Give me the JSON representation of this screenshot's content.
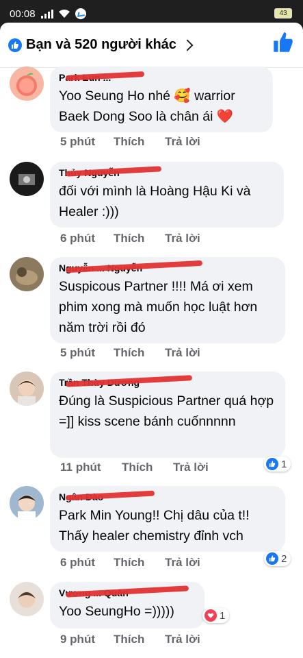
{
  "status_bar": {
    "time": "00:08",
    "battery": "43"
  },
  "header": {
    "title": "Bạn và 520 người khác"
  },
  "comments": [
    {
      "author": "Park Eun ...",
      "text": "Yoo Seung Ho nhé 🥰 warrior Baek Dong Soo là chân ái ❤️",
      "time": "5 phút",
      "like_label": "Thích",
      "reply_label": "Trả lời"
    },
    {
      "author": "Thủy Nguyễn",
      "text": "đối với mình là Hoàng Hậu Ki và Healer :)))",
      "time": "6 phút",
      "like_label": "Thích",
      "reply_label": "Trả lời"
    },
    {
      "author": "Nguyễn ... Nguyễn",
      "text": "Suspicous Partner !!!! Má ơi xem phim xong mà muốn học luật hơn năm trời rồi đó",
      "time": "5 phút",
      "like_label": "Thích",
      "reply_label": "Trả lời"
    },
    {
      "author": "Trần Thùy Dương",
      "text": "Đúng là Suspicious Partner quá hợp =]] kiss scene bánh cuốnnnnn",
      "time": "11 phút",
      "like_label": "Thích",
      "reply_label": "Trả lời",
      "reaction_count": "1"
    },
    {
      "author": "Ngân Đào",
      "text": "Park Min Young!! Chị dâu của t!! Thấy healer chemistry đỉnh vch",
      "time": "6 phút",
      "like_label": "Thích",
      "reply_label": "Trả lời",
      "reaction_count": "2"
    },
    {
      "author": "Vương ... Quân",
      "text": "Yoo SeungHo =)))))",
      "time": "9 phút",
      "like_label": "Thích",
      "reply_label": "Trả lời",
      "reaction_count": "1"
    }
  ],
  "colors": {
    "accent": "#1877f2",
    "redact": "#e03131",
    "heart": "#f33e58",
    "bubble": "#f0f2f5"
  }
}
